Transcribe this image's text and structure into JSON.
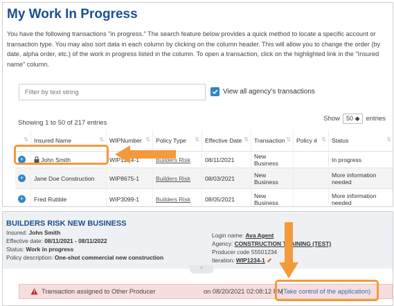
{
  "page": {
    "title": "My Work In Progress",
    "intro": "You have the following transactions \"in progress.\" The search feature below provides a quick method to locate a specific account or transaction type. You may also sort data in each column by clicking on the column header. This will allow you to change the order (by date, alpha order, etc.) of the work in progress listed in the column. To open a transaction, click on the highlighted link in the \"Insured name\" column."
  },
  "filter": {
    "placeholder": "Filter by text string",
    "view_all_label": "View all agency's transactions",
    "view_all_checked": true
  },
  "table": {
    "showing": "Showing 1 to 50 of 217 entries",
    "show_label": "Show",
    "entries_value": "50",
    "entries_label": "entries",
    "columns": [
      "Insured Name",
      "WIPNumber",
      "Policy Type",
      "Effective Date",
      "Transaction",
      "Policy #",
      "Status"
    ],
    "rows": [
      {
        "insured": "John Smith",
        "wip": "WIP1234-1",
        "policy_type": "Builders Risk",
        "effective": "08/11/2021",
        "transaction": "New Business",
        "policy_no": "",
        "status": "In progress",
        "locked": true
      },
      {
        "insured": "Jane Doe Construction",
        "wip": "WIP8675-1",
        "policy_type": "Builders Risk",
        "effective": "08/03/2021",
        "transaction": "New Business",
        "policy_no": "",
        "status": "More information needed",
        "locked": false
      },
      {
        "insured": "Fred Rubble",
        "wip": "WIP3099-1",
        "policy_type": "Builders Risk",
        "effective": "08/05/2021",
        "transaction": "New Business",
        "policy_no": "",
        "status": "More information needed",
        "locked": false
      }
    ]
  },
  "detail": {
    "title": "BUILDERS RISK NEW BUSINESS",
    "insured_label": "Insured:",
    "insured": "John Smith",
    "effective_label": "Effective date:",
    "effective": "08/11/2021 - 08/11/2022",
    "status_label": "Status:",
    "status": "Work in progress",
    "policy_desc_label": "Policy description:",
    "policy_desc": "One-shot commercial new construction",
    "login_label": "Login name:",
    "login": "Ava Agent",
    "agency_label": "Agency:",
    "agency": "CONSTRUCTION TRAINING (TEST)",
    "producer_label": "Producer code",
    "producer": "55501234",
    "iteration_label": "Iteration:",
    "iteration": "WIP1234-1"
  },
  "alert": {
    "assigned_text": "Transaction assigned to  Other Producer",
    "time_text": "on 08/20/2021 02:08:12 PM",
    "take_control": "(Take control of the application)"
  },
  "colors": {
    "accent": "#2f86c6",
    "title": "#1a4f8f",
    "highlight": "#f39a3b",
    "alert_bg": "#f6dede"
  }
}
